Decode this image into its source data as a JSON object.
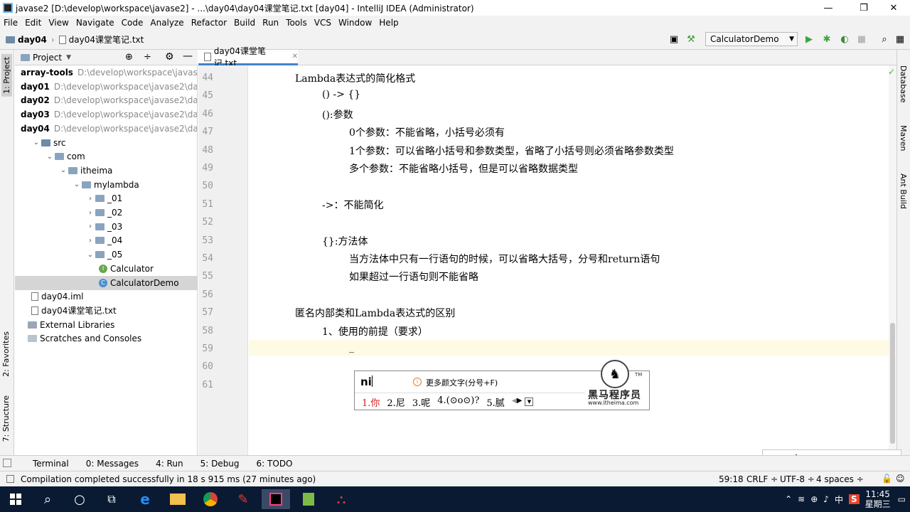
{
  "window": {
    "title": "javase2 [D:\\develop\\workspace\\javase2] - ...\\day04\\day04课堂笔记.txt [day04] - IntelliJ IDEA (Administrator)",
    "minimize": "—",
    "maximize": "❐",
    "close": "✕"
  },
  "menu": [
    "File",
    "Edit",
    "View",
    "Navigate",
    "Code",
    "Analyze",
    "Refactor",
    "Build",
    "Run",
    "Tools",
    "VCS",
    "Window",
    "Help"
  ],
  "breadcrumb": {
    "module": "day04",
    "file": "day04课堂笔记.txt"
  },
  "run_config": {
    "name": "CalculatorDemo"
  },
  "side_tabs": {
    "project": "1: Project",
    "favorites": "2: Favorites",
    "structure": "7: Structure"
  },
  "right_tabs": {
    "database": "Database",
    "maven": "Maven",
    "ant": "Ant Build"
  },
  "project_panel": {
    "title": "Project",
    "tree": [
      {
        "label": "array-tools",
        "path": "D:\\develop\\workspace\\javase2\\array-tools",
        "indent": 0,
        "kind": "module",
        "bold": true
      },
      {
        "label": "day01",
        "path": "D:\\develop\\workspace\\javase2\\day01",
        "indent": 0,
        "kind": "module",
        "bold": true
      },
      {
        "label": "day02",
        "path": "D:\\develop\\workspace\\javase2\\day02",
        "indent": 0,
        "kind": "module",
        "bold": true
      },
      {
        "label": "day03",
        "path": "D:\\develop\\workspace\\javase2\\day03",
        "indent": 0,
        "kind": "module",
        "bold": true
      },
      {
        "label": "day04",
        "path": "D:\\develop\\workspace\\javase2\\day04",
        "indent": 0,
        "kind": "module",
        "bold": true,
        "expanded": true
      },
      {
        "label": "src",
        "indent": 1,
        "kind": "folder",
        "expanded": true
      },
      {
        "label": "com",
        "indent": 2,
        "kind": "package",
        "expanded": true
      },
      {
        "label": "itheima",
        "indent": 3,
        "kind": "package",
        "expanded": true
      },
      {
        "label": "mylambda",
        "indent": 4,
        "kind": "package",
        "expanded": true
      },
      {
        "label": "_01",
        "indent": 5,
        "kind": "package"
      },
      {
        "label": "_02",
        "indent": 5,
        "kind": "package"
      },
      {
        "label": "_03",
        "indent": 5,
        "kind": "package"
      },
      {
        "label": "_04",
        "indent": 5,
        "kind": "package"
      },
      {
        "label": "_05",
        "indent": 5,
        "kind": "package",
        "expanded": true
      },
      {
        "label": "Calculator",
        "indent": 6,
        "kind": "interface"
      },
      {
        "label": "CalculatorDemo",
        "indent": 6,
        "kind": "class",
        "selected": true
      },
      {
        "label": "day04.iml",
        "indent": 1,
        "kind": "file"
      },
      {
        "label": "day04课堂笔记.txt",
        "indent": 1,
        "kind": "file"
      },
      {
        "label": "External Libraries",
        "indent": 0,
        "kind": "lib"
      },
      {
        "label": "Scratches and Consoles",
        "indent": 0,
        "kind": "scratch"
      }
    ]
  },
  "editor": {
    "tab": "day04课堂笔记.txt",
    "lines": [
      {
        "n": "44",
        "indent": 0,
        "text": "Lambda表达式的简化格式"
      },
      {
        "n": "45",
        "indent": 1,
        "text": "() -> {}"
      },
      {
        "n": "46",
        "indent": 1,
        "text": "():参数"
      },
      {
        "n": "47",
        "indent": 2,
        "text": "0个参数：不能省略，小括号必须有"
      },
      {
        "n": "48",
        "indent": 2,
        "text": "1个参数：可以省略小括号和参数类型，省略了小括号则必须省略参数类型"
      },
      {
        "n": "49",
        "indent": 2,
        "text": "多个参数：不能省略小括号，但是可以省略数据类型"
      },
      {
        "n": "50",
        "indent": 0,
        "text": ""
      },
      {
        "n": "51",
        "indent": 1,
        "text": "->：不能简化"
      },
      {
        "n": "52",
        "indent": 0,
        "text": ""
      },
      {
        "n": "53",
        "indent": 1,
        "text": "{}:方法体"
      },
      {
        "n": "54",
        "indent": 2,
        "text": "当方法体中只有一行语句的时候，可以省略大括号，分号和return语句"
      },
      {
        "n": "55",
        "indent": 2,
        "text": "如果超过一行语句则不能省略"
      },
      {
        "n": "56",
        "indent": 0,
        "text": ""
      },
      {
        "n": "57",
        "indent": 0,
        "text": "匿名内部类和Lambda表达式的区别"
      },
      {
        "n": "58",
        "indent": 1,
        "text": "1、使用的前提（要求）"
      },
      {
        "n": "59",
        "indent": 2,
        "text": "_"
      },
      {
        "n": "60",
        "indent": 0,
        "text": ""
      },
      {
        "n": "61",
        "indent": 0,
        "text": ""
      }
    ]
  },
  "ime_popup": {
    "input": "ni",
    "hint": "更多颜文字(分号+F)",
    "candidates": [
      "1.你",
      "2.尼",
      "3.呢",
      "4.(⊙o⊙)?",
      "5.腻"
    ],
    "brand": "黑马程序员",
    "brand_url": "www.itheima.com",
    "tm": "TM"
  },
  "ime_toolbar": {
    "lang": "中"
  },
  "bottom_tabs": [
    "Terminal",
    "0: Messages",
    "4: Run",
    "5: Debug",
    "6: TODO"
  ],
  "status": {
    "message": "Compilation completed successfully in 18 s 915 ms (27 minutes ago)",
    "position": "59:18",
    "line_sep": "CRLF ÷",
    "encoding": "UTF-8 ÷",
    "indent": "4 spaces ÷"
  },
  "taskbar": {
    "time": "11:45",
    "day": "星期三",
    "lang": "中"
  }
}
